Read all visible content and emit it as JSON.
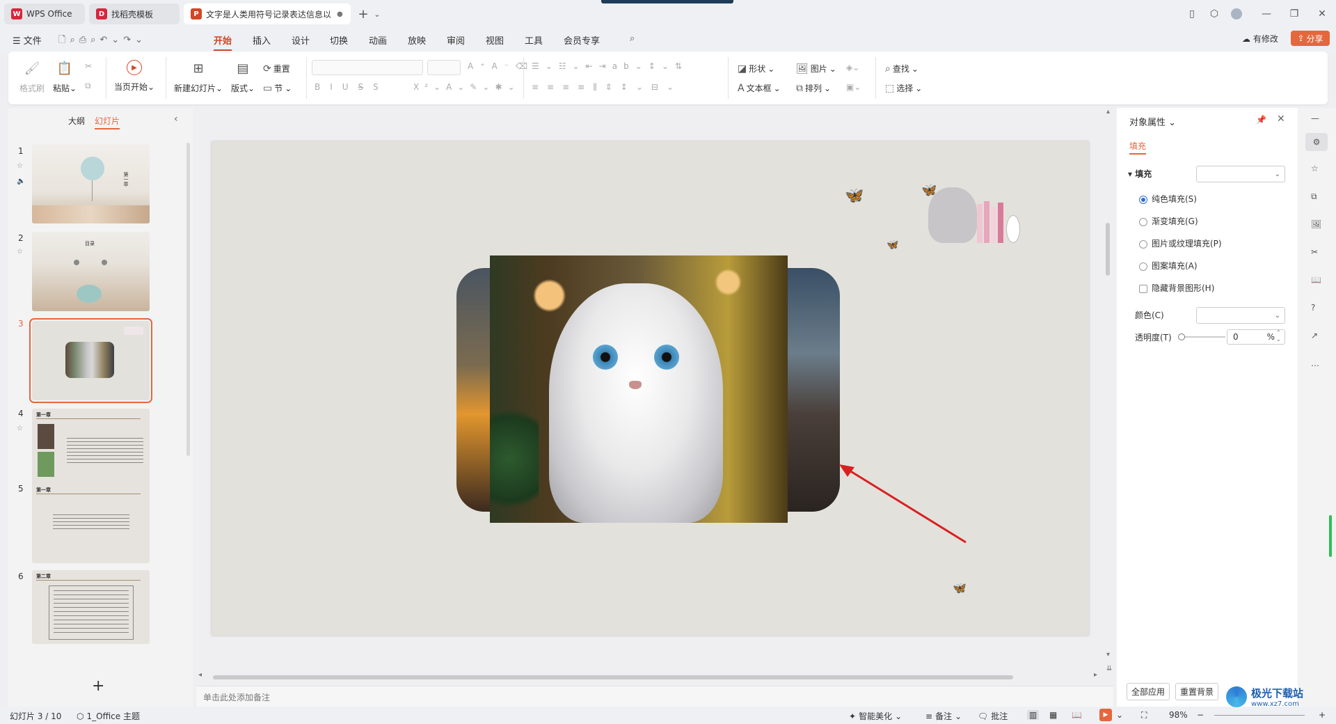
{
  "titlebar": {
    "tabs": [
      {
        "label": "WPS Office",
        "logo": "W",
        "color": "#d7263d"
      },
      {
        "label": "找稻壳模板",
        "logo": "D",
        "color": "#d7263d"
      },
      {
        "label": "文字是人类用符号记录表达信息以",
        "logo": "P",
        "color": "#d24726"
      }
    ],
    "new_tab": "+",
    "more": "⌄"
  },
  "menu": {
    "file": "文件",
    "tabs": [
      "开始",
      "插入",
      "设计",
      "切换",
      "动画",
      "放映",
      "审阅",
      "视图",
      "工具",
      "会员专享"
    ],
    "active_tab": "开始",
    "modified": "有修改",
    "share": "分享"
  },
  "ribbon": {
    "format_painter": "格式刷",
    "paste": "粘贴",
    "play_current": "当页开始",
    "new_slide": "新建幻灯片",
    "layout": "版式",
    "reset": "重置",
    "section": "节",
    "shape": "形状",
    "picture": "图片",
    "textbox": "文本框",
    "arrange": "排列",
    "find": "查找",
    "select": "选择"
  },
  "left_pane": {
    "tabs": [
      "大纲",
      "幻灯片"
    ],
    "active_tab": "幻灯片",
    "slides": [
      {
        "num": "1",
        "title": "第一章"
      },
      {
        "num": "2",
        "title": "目录"
      },
      {
        "num": "3",
        "title": ""
      },
      {
        "num": "4",
        "title": "第一章"
      },
      {
        "num": "5",
        "title": "第一章"
      },
      {
        "num": "6",
        "title": "第二章"
      }
    ],
    "selected": 3,
    "add": "+"
  },
  "notes": {
    "placeholder": "单击此处添加备注"
  },
  "right_pane": {
    "title": "对象属性",
    "tab": "填充",
    "section": "填充",
    "options": [
      {
        "label": "纯色填充(S)",
        "checked": true
      },
      {
        "label": "渐变填充(G)",
        "checked": false
      },
      {
        "label": "图片或纹理填充(P)",
        "checked": false
      },
      {
        "label": "图案填充(A)",
        "checked": false
      }
    ],
    "hide_bg": "隐藏背景图形(H)",
    "color_label": "颜色(C)",
    "transparency_label": "透明度(T)",
    "transparency_value": "0",
    "percent": "%",
    "apply_all": "全部应用",
    "reset_bg": "重置背景"
  },
  "status": {
    "slide_count": "幻灯片 3 / 10",
    "theme": "1_Office 主题",
    "beautify": "智能美化",
    "notes": "备注",
    "comments": "批注",
    "zoom": "98%"
  },
  "watermark": {
    "site": "极光下载站",
    "url": "www.xz7.com"
  }
}
